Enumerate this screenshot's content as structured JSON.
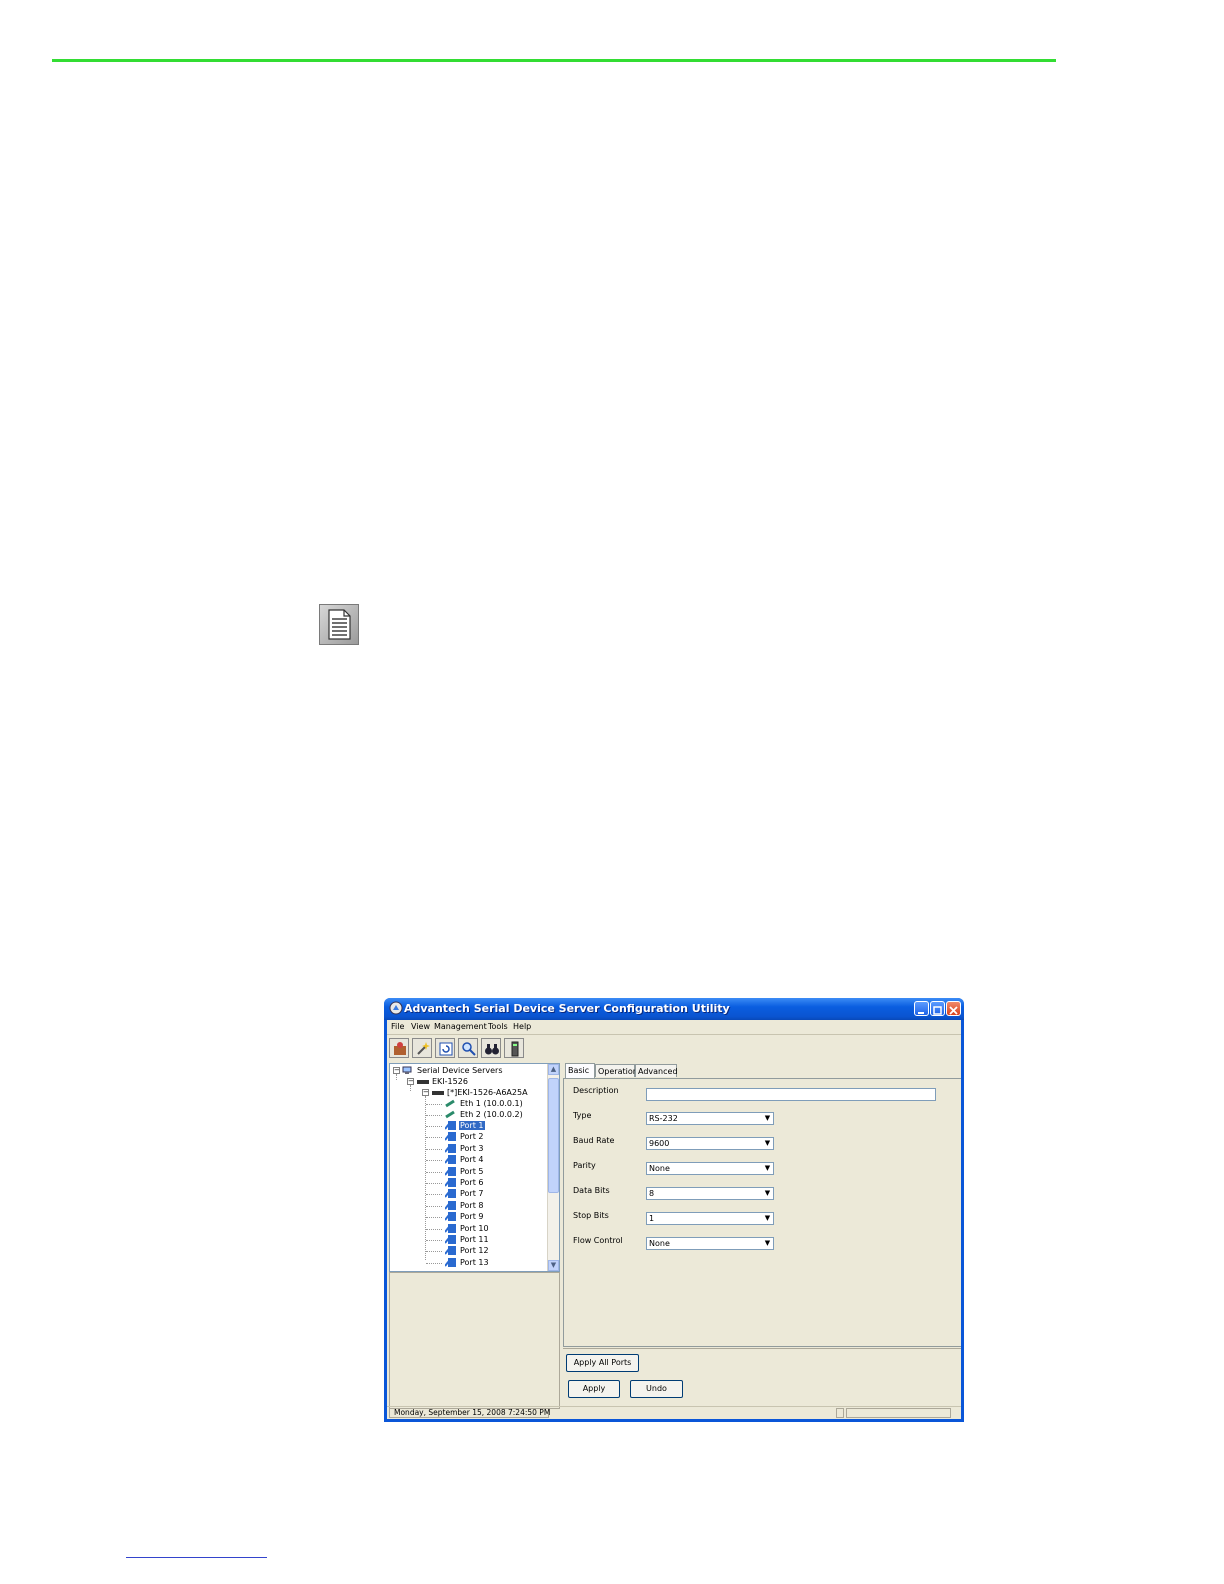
{
  "window": {
    "title": "Advantech Serial Device Server Configuration Utility"
  },
  "menu": [
    "File",
    "View",
    "Management",
    "Tools",
    "Help"
  ],
  "toolbar": {
    "buttons": [
      "add-device-icon",
      "search-wand-icon",
      "refresh-icon",
      "locate-icon",
      "binoculars-icon",
      "device-icon"
    ]
  },
  "tree": {
    "root": "Serial Device Servers",
    "group": "EKI-1526",
    "device": "[*]EKI-1526-A6A25A",
    "eth1": "Eth 1 (10.0.0.1)",
    "eth2": "Eth 2 (10.0.0.2)",
    "ports": [
      "Port 1",
      "Port 2",
      "Port 3",
      "Port 4",
      "Port 5",
      "Port 6",
      "Port 7",
      "Port 8",
      "Port 9",
      "Port 10",
      "Port 11",
      "Port 12",
      "Port 13"
    ],
    "selected_port": "Port 1"
  },
  "tabs": [
    "Basic",
    "Operation",
    "Advanced"
  ],
  "form": {
    "description_label": "Description",
    "description_value": "",
    "type_label": "Type",
    "type_value": "RS-232",
    "baud_label": "Baud Rate",
    "baud_value": "9600",
    "parity_label": "Parity",
    "parity_value": "None",
    "databits_label": "Data Bits",
    "databits_value": "8",
    "stopbits_label": "Stop Bits",
    "stopbits_value": "1",
    "flow_label": "Flow Control",
    "flow_value": "None"
  },
  "buttons": {
    "apply_all": "Apply All Ports",
    "apply": "Apply",
    "undo": "Undo"
  },
  "status": {
    "datetime": "Monday, September 15, 2008  7:24:50 PM"
  },
  "colors": {
    "header_rule": "#33dd33",
    "titlebar": "#0a56d8",
    "selection": "#316ac5"
  }
}
